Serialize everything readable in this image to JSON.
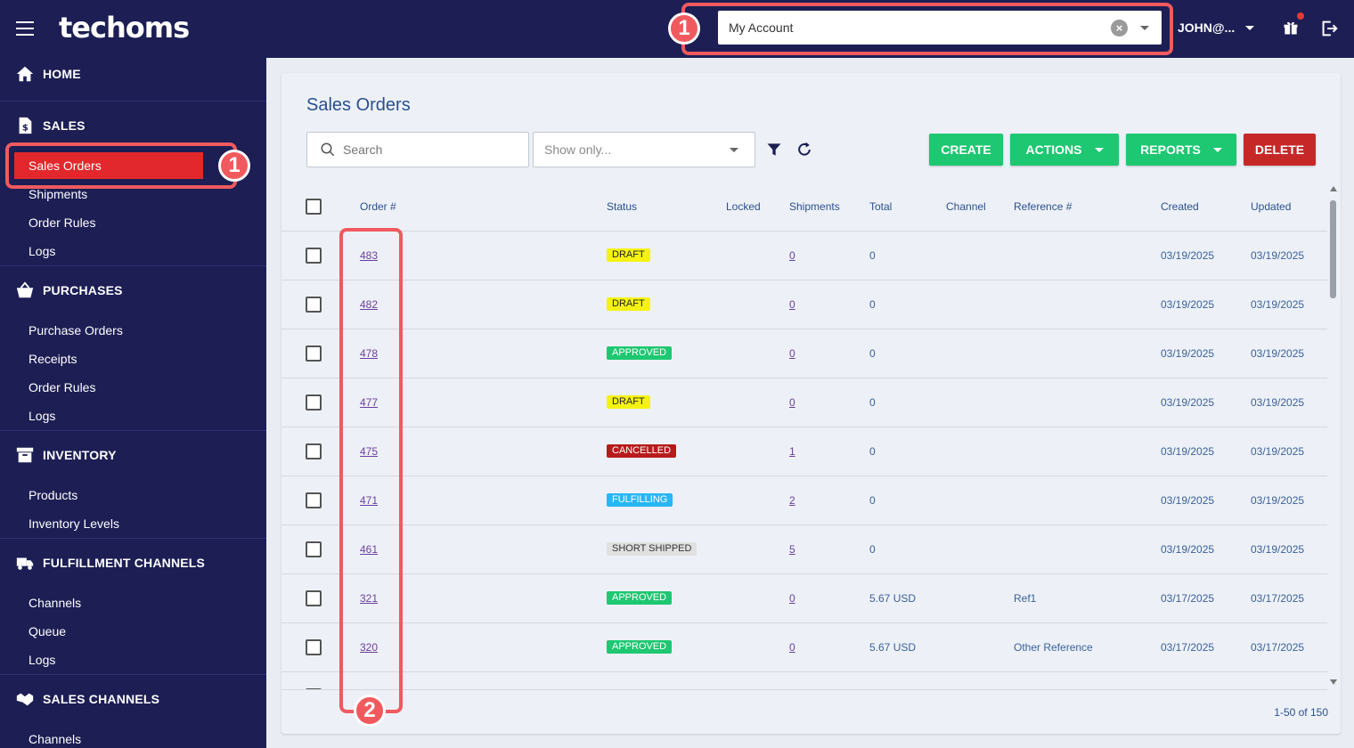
{
  "app": {
    "logo": "techoms"
  },
  "topbar": {
    "account": {
      "value": "My Account"
    },
    "user": "JOHN@...",
    "annotations": {
      "account_badge": "1"
    }
  },
  "sidebar": {
    "annotations": {
      "sales_orders_badge": "1"
    },
    "sections": {
      "home": "HOME",
      "sales": "SALES",
      "purchases": "PURCHASES",
      "inventory": "INVENTORY",
      "fulfillment": "FULFILLMENT CHANNELS",
      "sales_channels": "SALES CHANNELS"
    },
    "sales_items": [
      "Sales Orders",
      "Shipments",
      "Order Rules",
      "Logs"
    ],
    "purchases_items": [
      "Purchase Orders",
      "Receipts",
      "Order Rules",
      "Logs"
    ],
    "inventory_items": [
      "Products",
      "Inventory Levels"
    ],
    "fulfillment_items": [
      "Channels",
      "Queue",
      "Logs"
    ],
    "sales_channels_items": [
      "Channels"
    ]
  },
  "main": {
    "title": "Sales Orders",
    "search": {
      "placeholder": "Search",
      "value": ""
    },
    "show_only": {
      "placeholder": "Show only..."
    },
    "buttons": {
      "create": "CREATE",
      "actions": "ACTIONS",
      "reports": "REPORTS",
      "delete": "DELETE"
    },
    "columns": [
      "Order #",
      "Status",
      "Locked",
      "Shipments",
      "Total",
      "Channel",
      "Reference #",
      "Created",
      "Updated"
    ],
    "rows": [
      {
        "order": "483",
        "status": "DRAFT",
        "status_type": "draft",
        "locked": "",
        "shipments": "0",
        "total": "0",
        "channel": "",
        "reference": "",
        "created": "03/19/2025",
        "updated": "03/19/2025"
      },
      {
        "order": "482",
        "status": "DRAFT",
        "status_type": "draft",
        "locked": "",
        "shipments": "0",
        "total": "0",
        "channel": "",
        "reference": "",
        "created": "03/19/2025",
        "updated": "03/19/2025"
      },
      {
        "order": "478",
        "status": "APPROVED",
        "status_type": "approved",
        "locked": "",
        "shipments": "0",
        "total": "0",
        "channel": "",
        "reference": "",
        "created": "03/19/2025",
        "updated": "03/19/2025"
      },
      {
        "order": "477",
        "status": "DRAFT",
        "status_type": "draft",
        "locked": "",
        "shipments": "0",
        "total": "0",
        "channel": "",
        "reference": "",
        "created": "03/19/2025",
        "updated": "03/19/2025"
      },
      {
        "order": "475",
        "status": "CANCELLED",
        "status_type": "cancelled",
        "locked": "",
        "shipments": "1",
        "total": "0",
        "channel": "",
        "reference": "",
        "created": "03/19/2025",
        "updated": "03/19/2025"
      },
      {
        "order": "471",
        "status": "FULFILLING",
        "status_type": "fulfilling",
        "locked": "",
        "shipments": "2",
        "total": "0",
        "channel": "",
        "reference": "",
        "created": "03/19/2025",
        "updated": "03/19/2025"
      },
      {
        "order": "461",
        "status": "SHORT SHIPPED",
        "status_type": "short",
        "locked": "",
        "shipments": "5",
        "total": "0",
        "channel": "",
        "reference": "",
        "created": "03/19/2025",
        "updated": "03/19/2025"
      },
      {
        "order": "321",
        "status": "APPROVED",
        "status_type": "approved",
        "locked": "",
        "shipments": "0",
        "total": "5.67 USD",
        "channel": "",
        "reference": "Ref1",
        "created": "03/17/2025",
        "updated": "03/17/2025"
      },
      {
        "order": "320",
        "status": "APPROVED",
        "status_type": "approved",
        "locked": "",
        "shipments": "0",
        "total": "5.67 USD",
        "channel": "",
        "reference": "Other Reference",
        "created": "03/17/2025",
        "updated": "03/17/2025"
      }
    ],
    "pagination": "1-50 of 150",
    "annotations": {
      "order_column_badge": "2"
    }
  },
  "colors": {
    "nav_bg": "#1c1e54",
    "active_item": "#e2282d",
    "highlight": "#f05a5e",
    "green_button": "#1ec771",
    "delete_button": "#c62828"
  }
}
